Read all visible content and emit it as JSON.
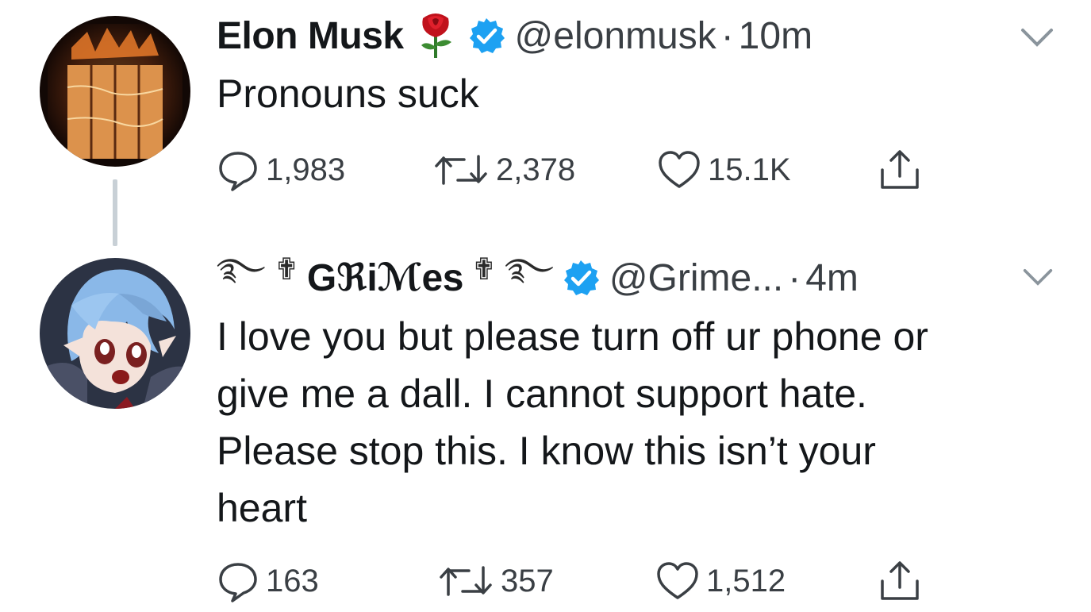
{
  "tweets": [
    {
      "name": "Elon Musk",
      "name_emoji": "🌹",
      "handle": "@elonmusk",
      "separator": "·",
      "time": "10m",
      "text": "Pronouns suck",
      "replies": "1,983",
      "retweets": "2,378",
      "likes": "15.1K",
      "avatar_icon": "burning-slab-avatar",
      "verified_icon": "verified-badge-icon"
    },
    {
      "name_prefix": "࿐ ✟",
      "name": "Gℜiℳes",
      "name_suffix": "✟ ࿐",
      "handle": "@Grime...",
      "separator": "·",
      "time": "4m",
      "text": "I love you but please turn off ur phone or\ngive me a dall.  I cannot support hate.\nPlease stop this. I know this isn’t your\nheart",
      "replies": "163",
      "retweets": "357",
      "likes": "1,512",
      "avatar_icon": "anime-character-avatar",
      "verified_icon": "verified-badge-icon"
    }
  ],
  "colors": {
    "verified": "#1da1f2",
    "text": "#14171a",
    "secondary": "#3a3f44",
    "thread_line": "#c8d0d6"
  }
}
